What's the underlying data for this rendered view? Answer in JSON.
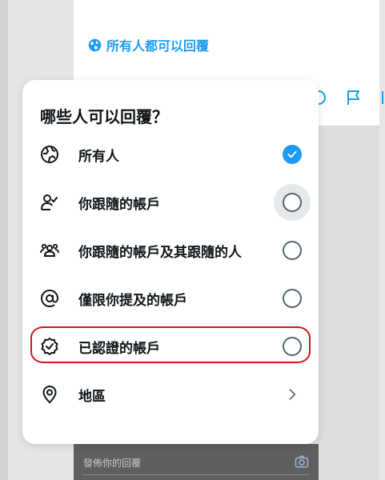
{
  "background": {
    "reply_setting_label": "所有人都可以回覆",
    "compose_placeholder": "發佈你的回覆"
  },
  "colors": {
    "accent": "#1d9bf0",
    "highlight": "#d0141f",
    "text": "#0f1419"
  },
  "popup": {
    "title": "哪些人可以回覆？",
    "options": [
      {
        "label": "所有人",
        "icon": "globe-icon",
        "control": "radio-checked"
      },
      {
        "label": "你跟隨的帳戶",
        "icon": "person-check-icon",
        "control": "radio-empty-hover"
      },
      {
        "label": "你跟隨的帳戶及其跟隨的人",
        "icon": "people-icon",
        "control": "radio-empty"
      },
      {
        "label": "僅限你提及的帳戶",
        "icon": "at-icon",
        "control": "radio-empty"
      },
      {
        "label": "已認證的帳戶",
        "icon": "verified-badge-icon",
        "control": "radio-empty"
      },
      {
        "label": "地區",
        "icon": "location-pin-icon",
        "control": "chevron-right"
      }
    ]
  }
}
